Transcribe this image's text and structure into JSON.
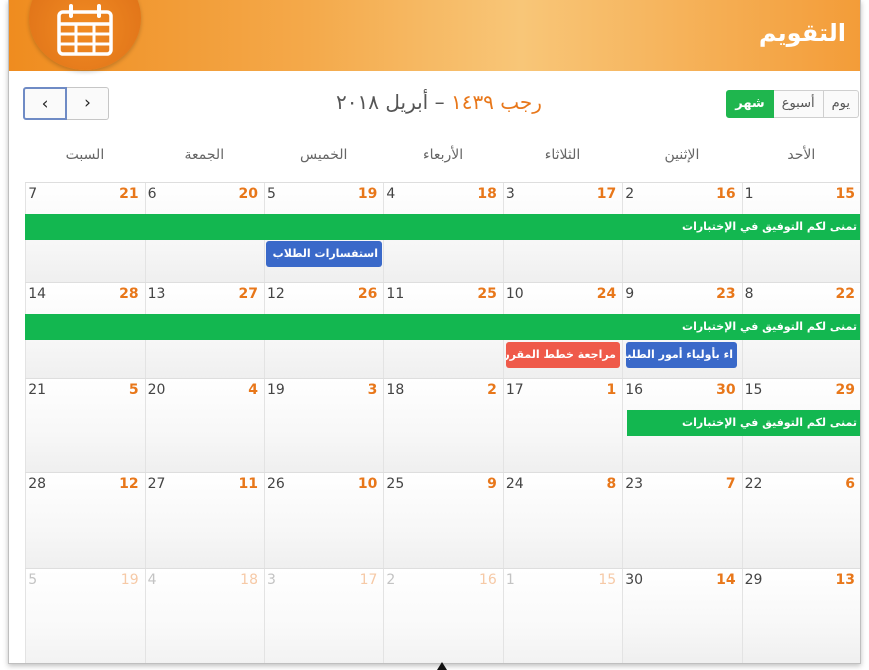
{
  "header": {
    "title": "التقويم",
    "icon": "calendar-icon"
  },
  "toolbar": {
    "prev_label": "‹",
    "next_label": "›",
    "range_hijri": "رجب ١٤٣٩",
    "range_sep": " – ",
    "range_greg": "أبريل ٢٠١٨",
    "views": {
      "day": "يوم",
      "week": "أسبوع",
      "month": "شهر"
    },
    "active_view": "month"
  },
  "weekdays": [
    "الأحد",
    "الإثنين",
    "الثلاثاء",
    "الأربعاء",
    "الخميس",
    "الجمعة",
    "السبت"
  ],
  "weeks": [
    {
      "days": [
        {
          "g": "1",
          "h": "15"
        },
        {
          "g": "2",
          "h": "16"
        },
        {
          "g": "3",
          "h": "17"
        },
        {
          "g": "4",
          "h": "18"
        },
        {
          "g": "5",
          "h": "19"
        },
        {
          "g": "6",
          "h": "20"
        },
        {
          "g": "7",
          "h": "21"
        }
      ]
    },
    {
      "days": [
        {
          "g": "8",
          "h": "22"
        },
        {
          "g": "9",
          "h": "23"
        },
        {
          "g": "10",
          "h": "24"
        },
        {
          "g": "11",
          "h": "25"
        },
        {
          "g": "12",
          "h": "26"
        },
        {
          "g": "13",
          "h": "27"
        },
        {
          "g": "14",
          "h": "28"
        }
      ]
    },
    {
      "days": [
        {
          "g": "15",
          "h": "29"
        },
        {
          "g": "16",
          "h": "30"
        },
        {
          "g": "17",
          "h": "1"
        },
        {
          "g": "18",
          "h": "2"
        },
        {
          "g": "19",
          "h": "3"
        },
        {
          "g": "20",
          "h": "4"
        },
        {
          "g": "21",
          "h": "5"
        }
      ]
    },
    {
      "days": [
        {
          "g": "22",
          "h": "6"
        },
        {
          "g": "23",
          "h": "7"
        },
        {
          "g": "24",
          "h": "8"
        },
        {
          "g": "25",
          "h": "9"
        },
        {
          "g": "26",
          "h": "10"
        },
        {
          "g": "27",
          "h": "11"
        },
        {
          "g": "28",
          "h": "12"
        }
      ]
    },
    {
      "days": [
        {
          "g": "29",
          "h": "13"
        },
        {
          "g": "30",
          "h": "14"
        },
        {
          "g": "1",
          "h": "15",
          "other": true
        },
        {
          "g": "2",
          "h": "16",
          "other": true
        },
        {
          "g": "3",
          "h": "17",
          "other": true
        },
        {
          "g": "4",
          "h": "18",
          "other": true
        },
        {
          "g": "5",
          "h": "19",
          "other": true
        }
      ]
    }
  ],
  "events": {
    "w1_exams": "تمنى لكم التوفيق في الإختبارات",
    "w1_inquiries": "استفسارات الطلاب",
    "w2_exams": "تمنى لكم التوفيق في الإختبارات",
    "w2_parents": "اء بأولياء أمور الطلبة",
    "w2_plans": "مراجعة خطط المقرر",
    "w3_exams": "تمنى لكم التوفيق في الإختبارات"
  },
  "colors": {
    "header": "#f39c38",
    "accent": "#e8771a",
    "event_green": "#13b750",
    "event_blue": "#3a69c9",
    "event_red": "#ef5a4a"
  }
}
